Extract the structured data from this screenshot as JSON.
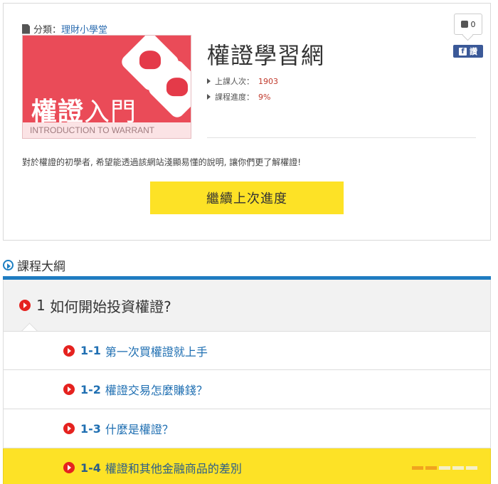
{
  "category": {
    "label": "分類：",
    "value": "理財小學堂"
  },
  "thumbnail": {
    "title_bold": "權證",
    "title_thin": "入門",
    "caption": "INTRODUCTION TO WARRANT"
  },
  "course": {
    "title": "權證學習網",
    "meta": [
      {
        "label": "上課人次：",
        "value": "1903"
      },
      {
        "label": "課程進度：",
        "value": "9%"
      }
    ],
    "description": "對於權證的初學者, 希望能透過該網站淺顯易懂的說明, 讓你們更了解權證!",
    "continue_label": "繼續上次進度"
  },
  "social": {
    "like_count": "0",
    "fb_label": "讚"
  },
  "outline": {
    "header": "課程大綱",
    "chapter": {
      "number": "1",
      "title": "如何開始投資權證?"
    },
    "lessons": [
      {
        "num": "1-1",
        "title": "第一次買權證就上手"
      },
      {
        "num": "1-2",
        "title": "權證交易怎麼賺錢？"
      },
      {
        "num": "1-3",
        "title": "什麼是權證？"
      },
      {
        "num": "1-4",
        "title": "權證和其他金融商品的差別",
        "active": true,
        "progress": 0.4
      }
    ]
  },
  "colors": {
    "accent_yellow": "#fde226",
    "accent_blue": "#1f7cc1",
    "accent_red": "#e5221f"
  }
}
